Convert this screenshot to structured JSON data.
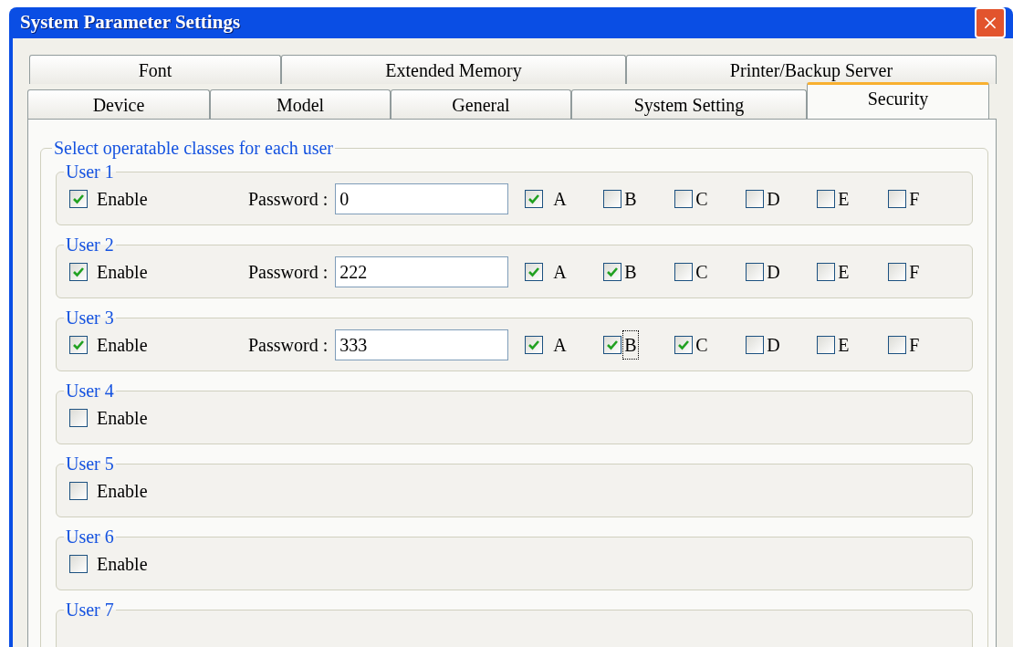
{
  "window": {
    "title": "System Parameter Settings",
    "close": "×"
  },
  "tab_rows": [
    [
      {
        "label": "Font",
        "selected": false
      },
      {
        "label": "Extended Memory",
        "selected": false
      },
      {
        "label": "Printer/Backup Server",
        "selected": false
      }
    ],
    [
      {
        "label": "Device",
        "selected": false
      },
      {
        "label": "Model",
        "selected": false
      },
      {
        "label": "General",
        "selected": false
      },
      {
        "label": "System Setting",
        "selected": false
      },
      {
        "label": "Security",
        "selected": true
      }
    ]
  ],
  "group": {
    "title": "Select operatable classes for each user"
  },
  "users": [
    {
      "title": "User 1",
      "enable": {
        "label": "Enable",
        "checked": true
      },
      "password_label": "Password :",
      "password": "0",
      "classes": [
        {
          "label": "A",
          "checked": true,
          "focused": false
        },
        {
          "label": "B",
          "checked": false,
          "focused": false
        },
        {
          "label": "C",
          "checked": false,
          "focused": false
        },
        {
          "label": "D",
          "checked": false,
          "focused": false
        },
        {
          "label": "E",
          "checked": false,
          "focused": false
        },
        {
          "label": "F",
          "checked": false,
          "focused": false
        }
      ]
    },
    {
      "title": "User 2",
      "enable": {
        "label": "Enable",
        "checked": true
      },
      "password_label": "Password :",
      "password": "222",
      "classes": [
        {
          "label": "A",
          "checked": true,
          "focused": false
        },
        {
          "label": "B",
          "checked": true,
          "focused": false
        },
        {
          "label": "C",
          "checked": false,
          "focused": false
        },
        {
          "label": "D",
          "checked": false,
          "focused": false
        },
        {
          "label": "E",
          "checked": false,
          "focused": false
        },
        {
          "label": "F",
          "checked": false,
          "focused": false
        }
      ]
    },
    {
      "title": "User 3",
      "enable": {
        "label": "Enable",
        "checked": true
      },
      "password_label": "Password :",
      "password": "333",
      "classes": [
        {
          "label": "A",
          "checked": true,
          "focused": false
        },
        {
          "label": "B",
          "checked": true,
          "focused": true
        },
        {
          "label": "C",
          "checked": true,
          "focused": false
        },
        {
          "label": "D",
          "checked": false,
          "focused": false
        },
        {
          "label": "E",
          "checked": false,
          "focused": false
        },
        {
          "label": "F",
          "checked": false,
          "focused": false
        }
      ]
    },
    {
      "title": "User 4",
      "enable": {
        "label": "Enable",
        "checked": false
      }
    },
    {
      "title": "User 5",
      "enable": {
        "label": "Enable",
        "checked": false
      }
    },
    {
      "title": "User 6",
      "enable": {
        "label": "Enable",
        "checked": false
      }
    },
    {
      "title": "User 7"
    }
  ]
}
